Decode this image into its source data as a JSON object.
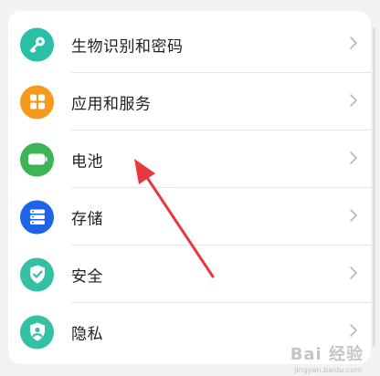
{
  "settings": {
    "items": [
      {
        "label": "生物识别和密码",
        "icon": "key-icon",
        "color": "#2bbfa8"
      },
      {
        "label": "应用和服务",
        "icon": "apps-grid-icon",
        "color": "#f59a1b"
      },
      {
        "label": "电池",
        "icon": "battery-icon",
        "color": "#3db455"
      },
      {
        "label": "存储",
        "icon": "storage-icon",
        "color": "#1e64e8"
      },
      {
        "label": "安全",
        "icon": "shield-check-icon",
        "color": "#33c0a4"
      },
      {
        "label": "隐私",
        "icon": "privacy-shield-icon",
        "color": "#33c0a4"
      }
    ]
  },
  "watermark": {
    "text": "Bai 经验",
    "sub": "jingyan.baidu.com"
  },
  "annotation": {
    "color": "#e8383d"
  }
}
